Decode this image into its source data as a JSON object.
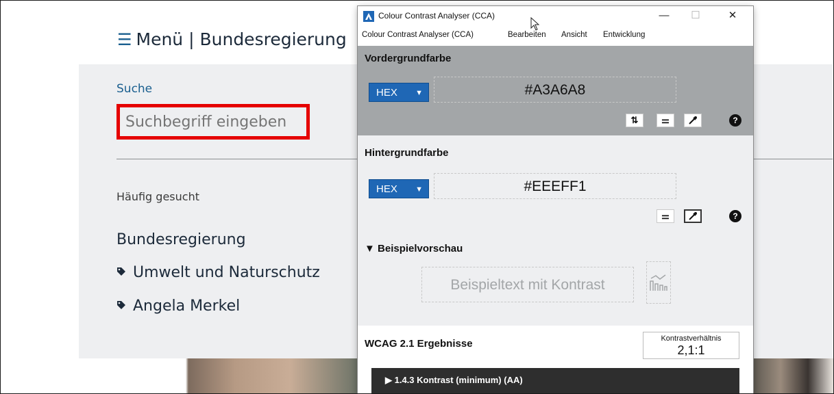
{
  "site": {
    "menu_label": "Menü | Bundesregierung",
    "search_label": "Suche",
    "search_placeholder": "Suchbegriff eingeben",
    "frequent_heading": "Häufig gesucht",
    "frequent_items": [
      {
        "label": "Bundesregierung",
        "icon": null
      },
      {
        "label": "Umwelt und Naturschutz",
        "icon": "tag-icon"
      },
      {
        "label": "Angela Merkel",
        "icon": "tag-icon"
      }
    ]
  },
  "cca": {
    "title": "Colour Contrast Analyser (CCA)",
    "menu": [
      "Colour Contrast Analyser (CCA)",
      "Bearbeiten",
      "Ansicht",
      "Entwicklung"
    ],
    "foreground": {
      "heading": "Vordergrundfarbe",
      "format": "HEX",
      "value": "#A3A6A8",
      "color": "#a3a6a8"
    },
    "background": {
      "heading": "Hintergrundfarbe",
      "format": "HEX",
      "value": "#EEEFF1",
      "color": "#eeeff1"
    },
    "preview": {
      "heading": "▼ Beispielvorschau",
      "sample_text": "Beispieltext mit Kontrast"
    },
    "results": {
      "heading": "WCAG 2.1 Ergebnisse",
      "ratio_label": "Kontrastverhältnis",
      "ratio_value": "2,1:1",
      "criterion": "▶ 1.4.3 Kontrast (minimum) (AA)"
    }
  },
  "colors": {
    "highlight_border": "#e50000",
    "hex_select_bg": "#1f67b5",
    "site_link": "#1a5f8f"
  }
}
